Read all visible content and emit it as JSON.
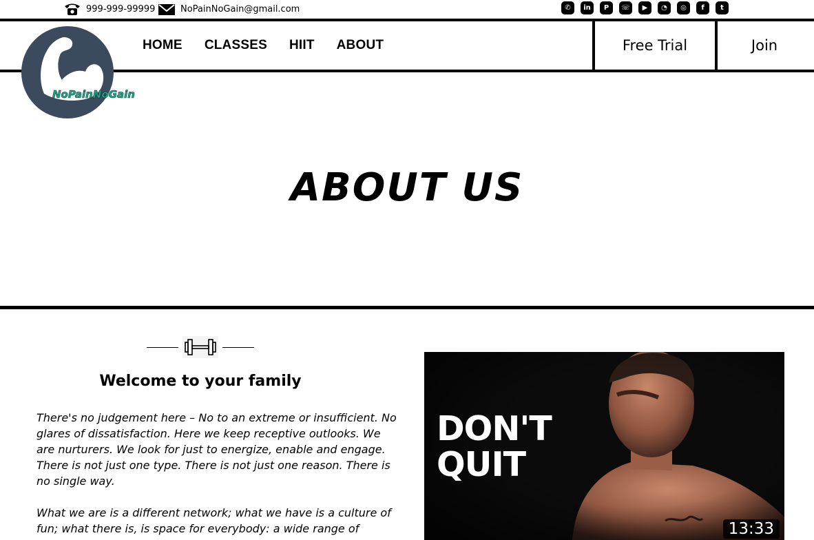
{
  "topbar": {
    "phone": "999-999-99999",
    "email": "NoPainNoGain@gmail.com",
    "socials": [
      {
        "name": "viber-icon",
        "glyph": "✆"
      },
      {
        "name": "linkedin-icon",
        "glyph": "in"
      },
      {
        "name": "pinterest-icon",
        "glyph": "P"
      },
      {
        "name": "whatsapp-icon",
        "glyph": "☏"
      },
      {
        "name": "youtube-icon",
        "glyph": "▶"
      },
      {
        "name": "snapchat-icon",
        "glyph": "◔"
      },
      {
        "name": "instagram-icon",
        "glyph": "◎"
      },
      {
        "name": "facebook-icon",
        "glyph": "f"
      },
      {
        "name": "twitter-icon",
        "glyph": "t"
      }
    ]
  },
  "logo": {
    "text": "NoPainNoGain",
    "color": "#3b4a5c",
    "text_color": "#1ea98a"
  },
  "nav": {
    "items": [
      "HOME",
      "CLASSES",
      "HIIT",
      "ABOUT"
    ],
    "free_trial": "Free Trial",
    "join": "Join"
  },
  "hero": {
    "title": "ABOUT US"
  },
  "content": {
    "heading": "Welcome to your family",
    "paragraph1": "There's no judgement here – No to an extreme or insufficient. No glares of dissatisfaction. Here we keep receptive outlooks. We are nurturers. We look for just to energize, enable and engage. There is not just one type. There is not just one reason. There is no single way.",
    "paragraph2": "What we are is a different network; what we have is a culture of fun; what there is, is space for everybody: a wide range of"
  },
  "video": {
    "overlay_line1": "DON'T",
    "overlay_line2": "QUIT",
    "duration": "13:33"
  }
}
